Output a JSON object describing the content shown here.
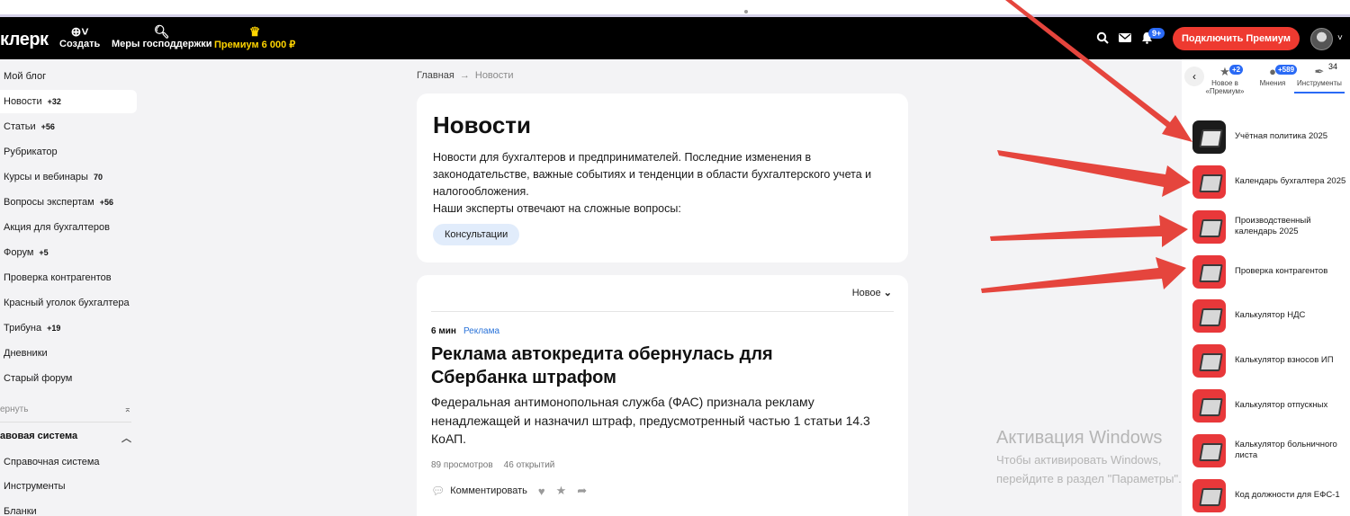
{
  "header": {
    "logo": "клерк",
    "create_label": "Создать",
    "support_label": "Меры господдержки",
    "premium_label": "Премиум 6 000 ₽",
    "notifications_badge": "9+",
    "connect_premium_label": "Подключить Премиум"
  },
  "sidebar": {
    "items": [
      {
        "label": "Мой блог",
        "badge": ""
      },
      {
        "label": "Новости",
        "badge": "+32"
      },
      {
        "label": "Статьи",
        "badge": "+56"
      },
      {
        "label": "Рубрикатор",
        "badge": ""
      },
      {
        "label": "Курсы и вебинары",
        "badge": "70"
      },
      {
        "label": "Вопросы экспертам",
        "badge": "+56"
      },
      {
        "label": "Акция для бухгалтеров",
        "badge": ""
      },
      {
        "label": "Форум",
        "badge": "+5"
      },
      {
        "label": "Проверка контрагентов",
        "badge": ""
      },
      {
        "label": "Красный уголок бухгалтера",
        "badge": ""
      },
      {
        "label": "Трибуна",
        "badge": "+19"
      },
      {
        "label": "Дневники",
        "badge": ""
      },
      {
        "label": "Старый форум",
        "badge": ""
      }
    ],
    "collapse_label": "ернуть",
    "section_title": "авовая система",
    "section_items": [
      "Справочная система",
      "Инструменты",
      "Бланки"
    ]
  },
  "breadcrumb": {
    "home": "Главная",
    "arrow": "→",
    "current": "Новости"
  },
  "news_intro": {
    "title": "Новости",
    "description": "Новости для бухгалтеров и предпринимателей. Последние изменения в законодательстве, важные событиях и тенденции в области бухгалтерского учета и налогообложения.",
    "experts_text": "Наши эксперты отвечают на сложные вопросы:",
    "consult_button": "Консультации"
  },
  "feed": {
    "sort_label": "Новое",
    "article": {
      "read_time": "6 мин",
      "tag": "Реклама",
      "title": "Реклама автокредита обернулась для Сбербанка штрафом",
      "lead": "Федеральная антимонопольная служба (ФАС) признала рекламу ненадлежащей и назначил штраф, предусмотренный частью 1 статьи 14.3 КоАП.",
      "views": "89 просмотров",
      "opens": "46 открытий",
      "comment_label": "Комментировать"
    }
  },
  "right_panel": {
    "tabs": [
      {
        "label": "Новое в «Премиум»",
        "badge": "+2"
      },
      {
        "label": "Мнения",
        "badge": "+589"
      },
      {
        "label": "Инструменты",
        "count": "34"
      }
    ],
    "tools": [
      "Учётная политика 2025",
      "Календарь бухгалтера 2025",
      "Производственный календарь 2025",
      "Проверка контрагентов",
      "Калькулятор НДС",
      "Калькулятор взносов ИП",
      "Калькулятор отпускных",
      "Калькулятор больничного листа",
      "Код должности для ЕФС-1"
    ]
  },
  "watermark": {
    "title": "Активация Windows",
    "text": "Чтобы активировать Windows, перейдите в раздел \"Параметры\"."
  },
  "colors": {
    "accent_red": "#ee3a30",
    "premium_yellow": "#ffd400",
    "link_blue": "#2a73d9",
    "arrow_red": "#e5453d"
  }
}
